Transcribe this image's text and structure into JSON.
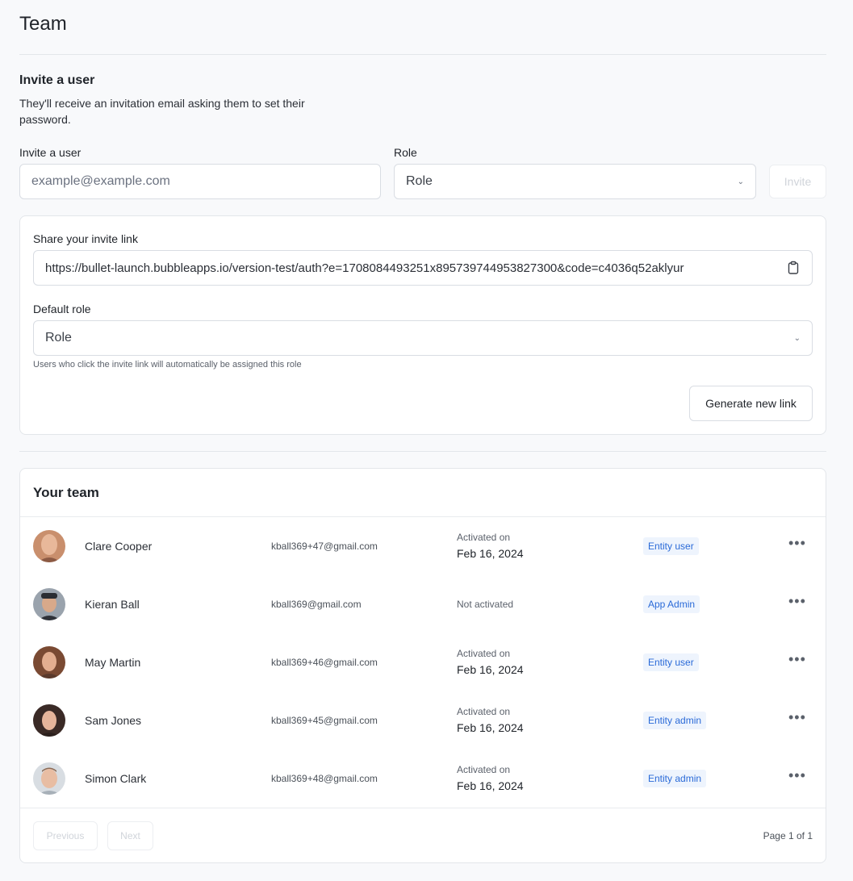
{
  "page": {
    "title": "Team"
  },
  "invite": {
    "title": "Invite a user",
    "description": "They'll receive an invitation email asking them to set their password.",
    "email_label": "Invite a user",
    "email_placeholder": "example@example.com",
    "role_label": "Role",
    "role_value": "Role",
    "invite_button": "Invite"
  },
  "invite_link": {
    "label": "Share your invite link",
    "url": "https://bullet-launch.bubbleapps.io/version-test/auth?e=1708084493251x895739744953827300&code=c4036q52aklyur",
    "default_role_label": "Default role",
    "default_role_value": "Role",
    "hint": "Users who click the invite link will automatically be assigned this role",
    "generate_button": "Generate new link"
  },
  "team": {
    "title": "Your team",
    "members": [
      {
        "name": "Clare Cooper",
        "email": "kball369+47@gmail.com",
        "status_label": "Activated on",
        "status_date": "Feb 16, 2024",
        "role": "Entity user"
      },
      {
        "name": "Kieran Ball",
        "email": "kball369@gmail.com",
        "status_label": "Not activated",
        "status_date": "",
        "role": "App Admin"
      },
      {
        "name": "May Martin",
        "email": "kball369+46@gmail.com",
        "status_label": "Activated on",
        "status_date": "Feb 16, 2024",
        "role": "Entity user"
      },
      {
        "name": "Sam Jones",
        "email": "kball369+45@gmail.com",
        "status_label": "Activated on",
        "status_date": "Feb 16, 2024",
        "role": "Entity admin"
      },
      {
        "name": "Simon Clark",
        "email": "kball369+48@gmail.com",
        "status_label": "Activated on",
        "status_date": "Feb 16, 2024",
        "role": "Entity admin"
      }
    ],
    "more_icon": "more-horizontal-icon",
    "previous_button": "Previous",
    "next_button": "Next",
    "page_info": "Page 1 of 1"
  },
  "colors": {
    "badge_bg": "#eef4fd",
    "badge_text": "#2a6ad8",
    "background": "#f8f9fb"
  }
}
